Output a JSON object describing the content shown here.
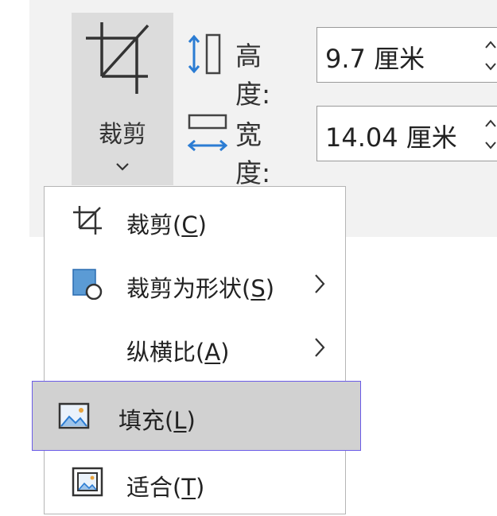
{
  "ribbon": {
    "crop_label": "裁剪",
    "height": {
      "label": "高度:",
      "value": "9.7 厘米"
    },
    "width": {
      "label": "宽度:",
      "value": "14.04 厘米"
    }
  },
  "menu": {
    "items": [
      {
        "text": "裁剪(",
        "key": "C",
        "tail": ")",
        "icon": "crop-icon",
        "submenu": false
      },
      {
        "text": "裁剪为形状(",
        "key": "S",
        "tail": ")",
        "icon": "crop-to-shape-icon",
        "submenu": true
      },
      {
        "text": "纵横比(",
        "key": "A",
        "tail": ")",
        "icon": "",
        "submenu": true
      },
      {
        "text": "填充(",
        "key": "L",
        "tail": ")",
        "icon": "fill-picture-icon",
        "submenu": false,
        "highlighted": true
      },
      {
        "text": "适合(",
        "key": "T",
        "tail": ")",
        "icon": "fit-picture-icon",
        "submenu": false
      }
    ]
  },
  "colors": {
    "accent_blue": "#2b7cd3",
    "highlight_border": "#6b5ce7",
    "highlight_bg": "#d1d1d1"
  }
}
